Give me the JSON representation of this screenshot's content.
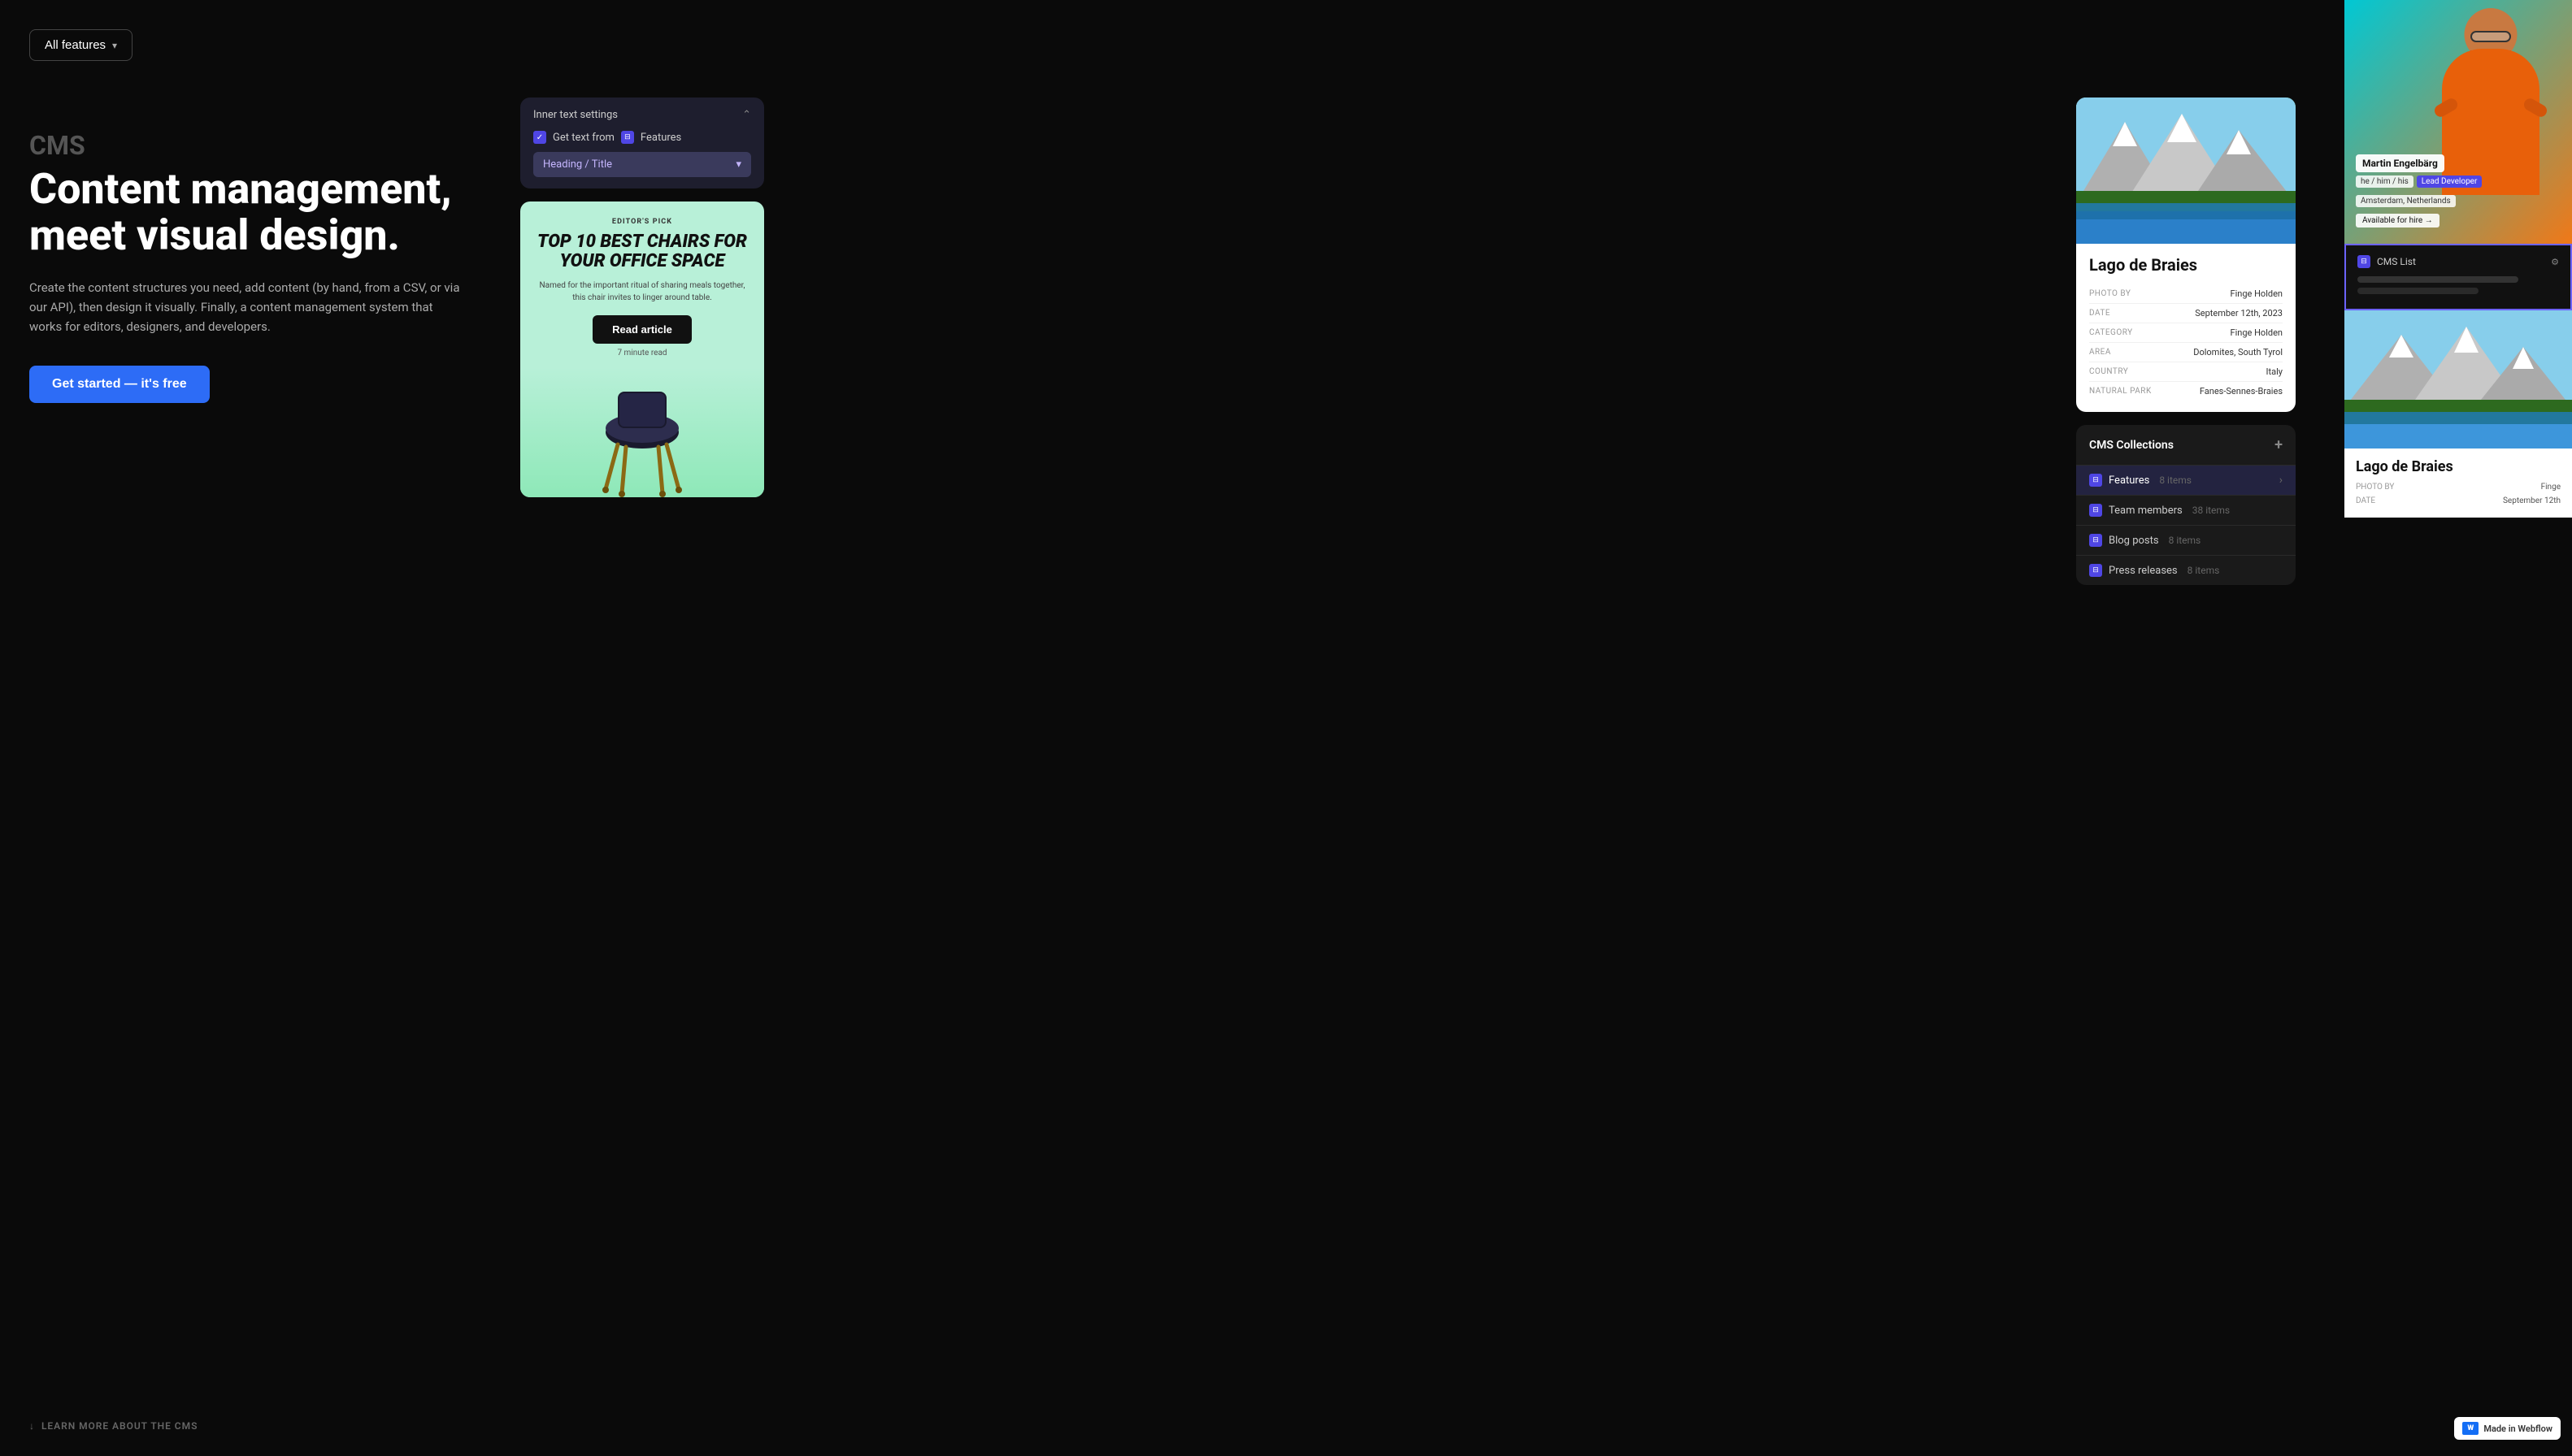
{
  "topbar": {
    "all_features_label": "All features"
  },
  "hero": {
    "label": "CMS",
    "title": "Content management,\nmeet visual design.",
    "description": "Create the content structures you need, add content (by hand, from a CSV, or via our API), then design it visually. Finally, a content management system that works for editors, designers, and developers.",
    "cta": "Get started — it's free",
    "learn_more": "LEARN MORE ABOUT THE CMS"
  },
  "inner_text_settings": {
    "title": "Inner text settings",
    "get_text_label": "Get text from",
    "source": "Features",
    "heading_select": "Heading / Title"
  },
  "article_card": {
    "editors_pick": "EDITOR'S PICK",
    "title": "TOP 10 BEST CHAIRS FOR YOUR OFFICE SPACE",
    "description": "Named for the important ritual of sharing meals together, this chair invites to linger around table.",
    "read_btn": "Read article",
    "minute_read": "7 minute read"
  },
  "location_card": {
    "name": "Lago de Braies",
    "fields": [
      {
        "label": "PHOTO BY",
        "value": "Finge Holden"
      },
      {
        "label": "DATE",
        "value": "September 12th, 2023"
      },
      {
        "label": "CATEGORY",
        "value": "Finge Holden"
      },
      {
        "label": "AREA",
        "value": "Dolomites, South Tyrol"
      },
      {
        "label": "COUNTRY",
        "value": "Italy"
      },
      {
        "label": "NATURAL PARK",
        "value": "Fanes-Sennes-Braies"
      }
    ]
  },
  "cms_collections": {
    "title": "CMS Collections",
    "items": [
      {
        "label": "Features",
        "count": "8 items",
        "active": true
      },
      {
        "label": "Team members",
        "count": "38 items",
        "active": false
      },
      {
        "label": "Blog posts",
        "count": "8 items",
        "active": false
      },
      {
        "label": "Press releases",
        "count": "8 items",
        "active": false
      }
    ]
  },
  "profile": {
    "name": "Martin Engelbärg",
    "pronouns": "he / him / his",
    "role": "Lead Developer",
    "location": "Amsterdam, Netherlands",
    "hire_label": "Available for hire →"
  },
  "cms_list": {
    "label": "CMS List"
  },
  "location_card_2": {
    "name": "Lago de Braies",
    "photo_by_label": "PHOTO BY",
    "photo_by_value": "Finge",
    "date_label": "DATE",
    "date_value": "September 12th"
  },
  "webflow_badge": {
    "label": "Made in Webflow"
  }
}
